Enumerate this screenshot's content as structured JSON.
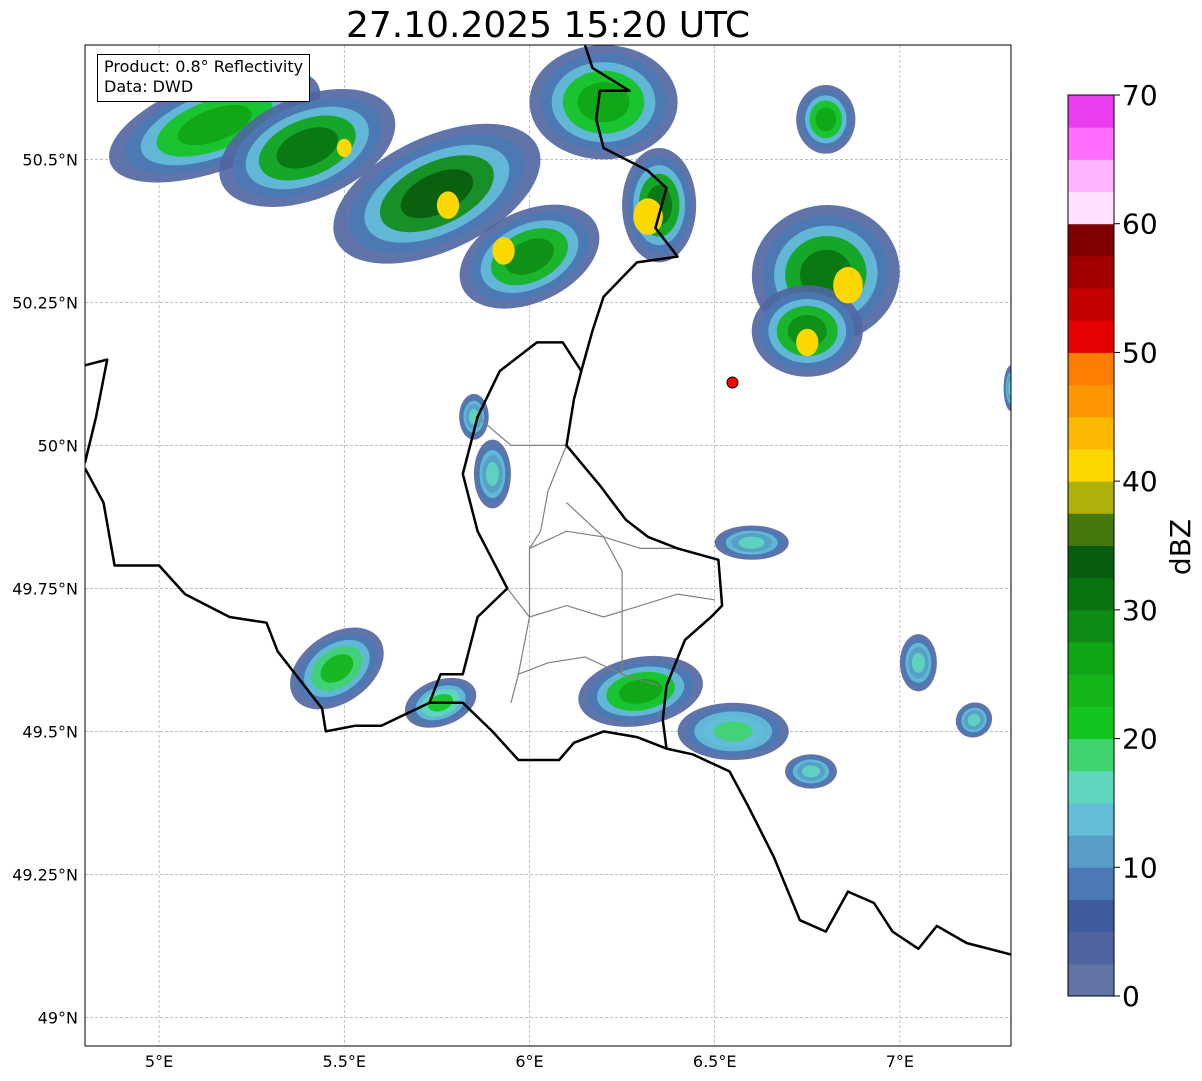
{
  "title": "27.10.2025 15:20 UTC",
  "info_box": {
    "product": "Product: 0.8° Reflectivity",
    "data_source": "Data: DWD"
  },
  "map": {
    "extent": {
      "lon": [
        4.8,
        7.3
      ],
      "lat": [
        48.95,
        50.7
      ]
    },
    "x_ticks": [
      {
        "value": 5.0,
        "label": "5°E"
      },
      {
        "value": 5.5,
        "label": "5.5°E"
      },
      {
        "value": 6.0,
        "label": "6°E"
      },
      {
        "value": 6.5,
        "label": "6.5°E"
      },
      {
        "value": 7.0,
        "label": "7°E"
      }
    ],
    "y_ticks": [
      {
        "value": 50.5,
        "label": "50.5°N"
      },
      {
        "value": 50.25,
        "label": "50.25°N"
      },
      {
        "value": 50.0,
        "label": "50°N"
      },
      {
        "value": 49.75,
        "label": "49.75°N"
      },
      {
        "value": 49.5,
        "label": "49.5°N"
      },
      {
        "value": 49.25,
        "label": "49.25°N"
      },
      {
        "value": 49.0,
        "label": "49°N"
      }
    ],
    "radar_site": {
      "lon": 6.548,
      "lat": 50.11,
      "color": "#ff0000"
    },
    "echo_cells": [
      {
        "lon": 5.15,
        "lat": 50.56,
        "rlon": 0.3,
        "rlat": 0.08,
        "rot": -20,
        "dbz": 22
      },
      {
        "lon": 5.4,
        "lat": 50.52,
        "rlon": 0.25,
        "rlat": 0.09,
        "rot": -22,
        "dbz": 26
      },
      {
        "lon": 5.75,
        "lat": 50.44,
        "rlon": 0.3,
        "rlat": 0.1,
        "rot": -25,
        "dbz": 28
      },
      {
        "lon": 6.0,
        "lat": 50.33,
        "rlon": 0.2,
        "rlat": 0.08,
        "rot": -25,
        "dbz": 24
      },
      {
        "lon": 6.2,
        "lat": 50.6,
        "rlon": 0.2,
        "rlat": 0.1,
        "rot": 0,
        "dbz": 20
      },
      {
        "lon": 6.35,
        "lat": 50.42,
        "rlon": 0.1,
        "rlat": 0.1,
        "rot": 0,
        "dbz": 26
      },
      {
        "lon": 6.8,
        "lat": 50.3,
        "rlon": 0.2,
        "rlat": 0.12,
        "rot": -10,
        "dbz": 26
      },
      {
        "lon": 6.75,
        "lat": 50.2,
        "rlon": 0.15,
        "rlat": 0.08,
        "rot": 0,
        "dbz": 24
      },
      {
        "lon": 6.8,
        "lat": 50.57,
        "rlon": 0.08,
        "rlat": 0.06,
        "rot": 0,
        "dbz": 20
      },
      {
        "lon": 5.48,
        "lat": 49.61,
        "rlon": 0.14,
        "rlat": 0.06,
        "rot": -35,
        "dbz": 18
      },
      {
        "lon": 5.76,
        "lat": 49.55,
        "rlon": 0.1,
        "rlat": 0.04,
        "rot": -20,
        "dbz": 16
      },
      {
        "lon": 6.3,
        "lat": 49.57,
        "rlon": 0.17,
        "rlat": 0.06,
        "rot": -10,
        "dbz": 22
      },
      {
        "lon": 6.55,
        "lat": 49.5,
        "rlon": 0.15,
        "rlat": 0.05,
        "rot": 0,
        "dbz": 14
      },
      {
        "lon": 6.76,
        "lat": 49.43,
        "rlon": 0.07,
        "rlat": 0.03,
        "rot": 0,
        "dbz": 10
      },
      {
        "lon": 7.05,
        "lat": 49.62,
        "rlon": 0.05,
        "rlat": 0.05,
        "rot": 0,
        "dbz": 10
      },
      {
        "lon": 7.2,
        "lat": 49.52,
        "rlon": 0.05,
        "rlat": 0.03,
        "rot": -30,
        "dbz": 12
      },
      {
        "lon": 6.6,
        "lat": 49.83,
        "rlon": 0.1,
        "rlat": 0.03,
        "rot": 0,
        "dbz": 12
      },
      {
        "lon": 5.9,
        "lat": 49.95,
        "rlon": 0.05,
        "rlat": 0.06,
        "rot": 0,
        "dbz": 10
      },
      {
        "lon": 5.85,
        "lat": 50.05,
        "rlon": 0.04,
        "rlat": 0.04,
        "rot": 0,
        "dbz": 10
      },
      {
        "lon": 7.3,
        "lat": 50.1,
        "rlon": 0.02,
        "rlat": 0.04,
        "rot": 0,
        "dbz": 12
      }
    ],
    "cores": [
      {
        "lon": 5.5,
        "lat": 50.52,
        "r": 0.02,
        "dbz": 40
      },
      {
        "lon": 5.78,
        "lat": 50.42,
        "r": 0.03,
        "dbz": 40
      },
      {
        "lon": 5.93,
        "lat": 50.34,
        "r": 0.03,
        "dbz": 40
      },
      {
        "lon": 6.32,
        "lat": 50.4,
        "r": 0.04,
        "dbz": 40
      },
      {
        "lon": 6.86,
        "lat": 50.28,
        "r": 0.04,
        "dbz": 40
      },
      {
        "lon": 6.75,
        "lat": 50.18,
        "r": 0.03,
        "dbz": 40
      }
    ],
    "borders_country": [
      {
        "name": "fr-be-lu",
        "coords": [
          [
            4.8,
            49.96
          ],
          [
            4.85,
            49.9
          ],
          [
            4.88,
            49.79
          ],
          [
            5.0,
            49.79
          ],
          [
            5.07,
            49.74
          ],
          [
            5.19,
            49.7
          ],
          [
            5.29,
            49.69
          ],
          [
            5.32,
            49.64
          ],
          [
            5.44,
            49.54
          ],
          [
            5.45,
            49.5
          ],
          [
            5.53,
            49.51
          ],
          [
            5.6,
            49.51
          ],
          [
            5.73,
            49.55
          ],
          [
            5.82,
            49.55
          ],
          [
            5.9,
            49.5
          ],
          [
            5.97,
            49.45
          ],
          [
            6.08,
            49.45
          ],
          [
            6.12,
            49.48
          ],
          [
            6.2,
            49.5
          ],
          [
            6.29,
            49.49
          ],
          [
            6.37,
            49.47
          ],
          [
            6.44,
            49.46
          ],
          [
            6.54,
            49.43
          ],
          [
            6.59,
            49.37
          ],
          [
            6.66,
            49.28
          ],
          [
            6.73,
            49.17
          ],
          [
            6.8,
            49.15
          ],
          [
            6.86,
            49.22
          ],
          [
            6.93,
            49.2
          ],
          [
            6.98,
            49.15
          ],
          [
            7.05,
            49.12
          ],
          [
            7.1,
            49.16
          ],
          [
            7.18,
            49.13
          ],
          [
            7.3,
            49.11
          ]
        ]
      },
      {
        "name": "be-lu-de",
        "coords": [
          [
            5.73,
            49.55
          ],
          [
            5.76,
            49.6
          ],
          [
            5.82,
            49.6
          ],
          [
            5.86,
            49.7
          ],
          [
            5.94,
            49.75
          ],
          [
            5.86,
            49.85
          ],
          [
            5.82,
            49.95
          ],
          [
            5.86,
            50.05
          ],
          [
            5.92,
            50.13
          ],
          [
            6.02,
            50.18
          ],
          [
            6.09,
            50.18
          ],
          [
            6.14,
            50.13
          ],
          [
            6.12,
            50.08
          ],
          [
            6.1,
            50.0
          ],
          [
            6.19,
            49.93
          ],
          [
            6.26,
            49.87
          ],
          [
            6.32,
            49.84
          ],
          [
            6.4,
            49.82
          ],
          [
            6.51,
            49.8
          ],
          [
            6.52,
            49.72
          ],
          [
            6.49,
            49.7
          ],
          [
            6.42,
            49.66
          ],
          [
            6.37,
            49.58
          ],
          [
            6.36,
            49.52
          ],
          [
            6.37,
            49.47
          ]
        ]
      },
      {
        "name": "be-de",
        "coords": [
          [
            6.14,
            50.13
          ],
          [
            6.17,
            50.2
          ],
          [
            6.2,
            50.26
          ],
          [
            6.26,
            50.3
          ],
          [
            6.29,
            50.32
          ],
          [
            6.4,
            50.33
          ],
          [
            6.34,
            50.38
          ],
          [
            6.37,
            50.45
          ],
          [
            6.32,
            50.48
          ],
          [
            6.2,
            50.52
          ],
          [
            6.18,
            50.57
          ],
          [
            6.19,
            50.62
          ],
          [
            6.27,
            50.62
          ],
          [
            6.17,
            50.66
          ],
          [
            6.15,
            50.7
          ]
        ]
      },
      {
        "name": "fr-be-w",
        "coords": [
          [
            4.8,
            50.14
          ],
          [
            4.86,
            50.15
          ],
          [
            4.83,
            50.05
          ],
          [
            4.8,
            49.97
          ]
        ]
      }
    ],
    "borders_admin": [
      {
        "coords": [
          [
            5.94,
            49.75
          ],
          [
            6.0,
            49.7
          ],
          [
            6.1,
            49.72
          ],
          [
            6.2,
            49.7
          ],
          [
            6.3,
            49.72
          ],
          [
            6.4,
            49.74
          ],
          [
            6.5,
            49.73
          ]
        ]
      },
      {
        "coords": [
          [
            5.97,
            49.6
          ],
          [
            6.05,
            49.62
          ],
          [
            6.15,
            49.63
          ],
          [
            6.25,
            49.6
          ],
          [
            6.35,
            49.58
          ]
        ]
      },
      {
        "coords": [
          [
            6.0,
            49.82
          ],
          [
            6.1,
            49.85
          ],
          [
            6.2,
            49.84
          ],
          [
            6.3,
            49.82
          ],
          [
            6.4,
            49.82
          ]
        ]
      },
      {
        "coords": [
          [
            6.1,
            50.0
          ],
          [
            6.05,
            49.92
          ],
          [
            6.03,
            49.85
          ],
          [
            6.0,
            49.82
          ],
          [
            6.0,
            49.75
          ],
          [
            6.0,
            49.7
          ],
          [
            5.97,
            49.6
          ],
          [
            5.95,
            49.55
          ]
        ]
      },
      {
        "coords": [
          [
            6.2,
            49.84
          ],
          [
            6.25,
            49.78
          ],
          [
            6.25,
            49.7
          ],
          [
            6.25,
            49.6
          ]
        ]
      },
      {
        "coords": [
          [
            5.86,
            50.05
          ],
          [
            5.95,
            50.0
          ],
          [
            6.02,
            50.0
          ],
          [
            6.1,
            50.0
          ]
        ]
      },
      {
        "coords": [
          [
            6.1,
            49.9
          ],
          [
            6.15,
            49.87
          ],
          [
            6.2,
            49.84
          ]
        ]
      }
    ]
  },
  "colorbar": {
    "label": "dBZ",
    "min": 0,
    "max": 70,
    "tick_values": [
      0,
      10,
      20,
      30,
      40,
      50,
      60,
      70
    ],
    "bins": [
      {
        "from": 0,
        "color": "#6374a7"
      },
      {
        "from": 2.5,
        "color": "#5065a0"
      },
      {
        "from": 5,
        "color": "#3f5ba0"
      },
      {
        "from": 7.5,
        "color": "#4a79b5"
      },
      {
        "from": 10,
        "color": "#579dc6"
      },
      {
        "from": 12.5,
        "color": "#64bed8"
      },
      {
        "from": 15,
        "color": "#5fd7be"
      },
      {
        "from": 17.5,
        "color": "#3fd46e"
      },
      {
        "from": 20,
        "color": "#13c51f"
      },
      {
        "from": 22.5,
        "color": "#13b519"
      },
      {
        "from": 25,
        "color": "#10a515"
      },
      {
        "from": 27.5,
        "color": "#0e8c14"
      },
      {
        "from": 30,
        "color": "#0a7411"
      },
      {
        "from": 32.5,
        "color": "#085c0d"
      },
      {
        "from": 35,
        "color": "#47780e"
      },
      {
        "from": 37.5,
        "color": "#aeb10c"
      },
      {
        "from": 40,
        "color": "#fdd700"
      },
      {
        "from": 42.5,
        "color": "#fdb802"
      },
      {
        "from": 45,
        "color": "#fd9602"
      },
      {
        "from": 47.5,
        "color": "#fd7c02"
      },
      {
        "from": 50,
        "color": "#e60000"
      },
      {
        "from": 52.5,
        "color": "#c40000"
      },
      {
        "from": 55,
        "color": "#a20000"
      },
      {
        "from": 57.5,
        "color": "#7e0000"
      },
      {
        "from": 60,
        "color": "#ffe2ff"
      },
      {
        "from": 62.5,
        "color": "#ffb4ff"
      },
      {
        "from": 65,
        "color": "#ff6eff"
      },
      {
        "from": 67.5,
        "color": "#eb3cf0"
      }
    ]
  }
}
